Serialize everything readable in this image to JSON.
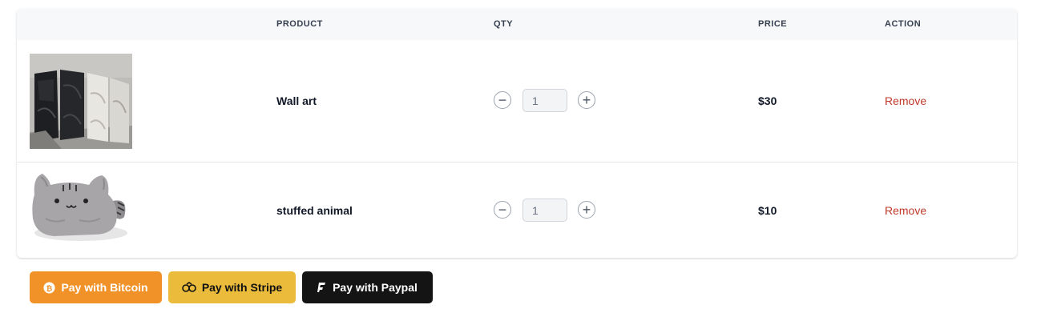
{
  "table": {
    "headers": {
      "image": "",
      "product": "PRODUCT",
      "qty": "QTY",
      "price": "PRICE",
      "action": "ACTION"
    },
    "rows": [
      {
        "image_icon": "wall-art-photo",
        "product": "Wall art",
        "qty": "1",
        "price": "$30",
        "action": "Remove"
      },
      {
        "image_icon": "stuffed-cat-photo",
        "product": "stuffed animal",
        "qty": "1",
        "price": "$10",
        "action": "Remove"
      }
    ],
    "qty_minus_symbol": "−",
    "qty_plus_symbol": "+"
  },
  "payment": {
    "bitcoin": {
      "label": "Pay with Bitcoin",
      "icon": "bitcoin-icon",
      "color": "#f19229"
    },
    "stripe": {
      "label": "Pay with Stripe",
      "icon": "stripe-icon",
      "color": "#ebbb3c"
    },
    "paypal": {
      "label": "Pay with Paypal",
      "icon": "paypal-icon",
      "color": "#141414"
    }
  },
  "colors": {
    "remove_link": "#c0392b",
    "header_bg": "#f7f8fa"
  }
}
